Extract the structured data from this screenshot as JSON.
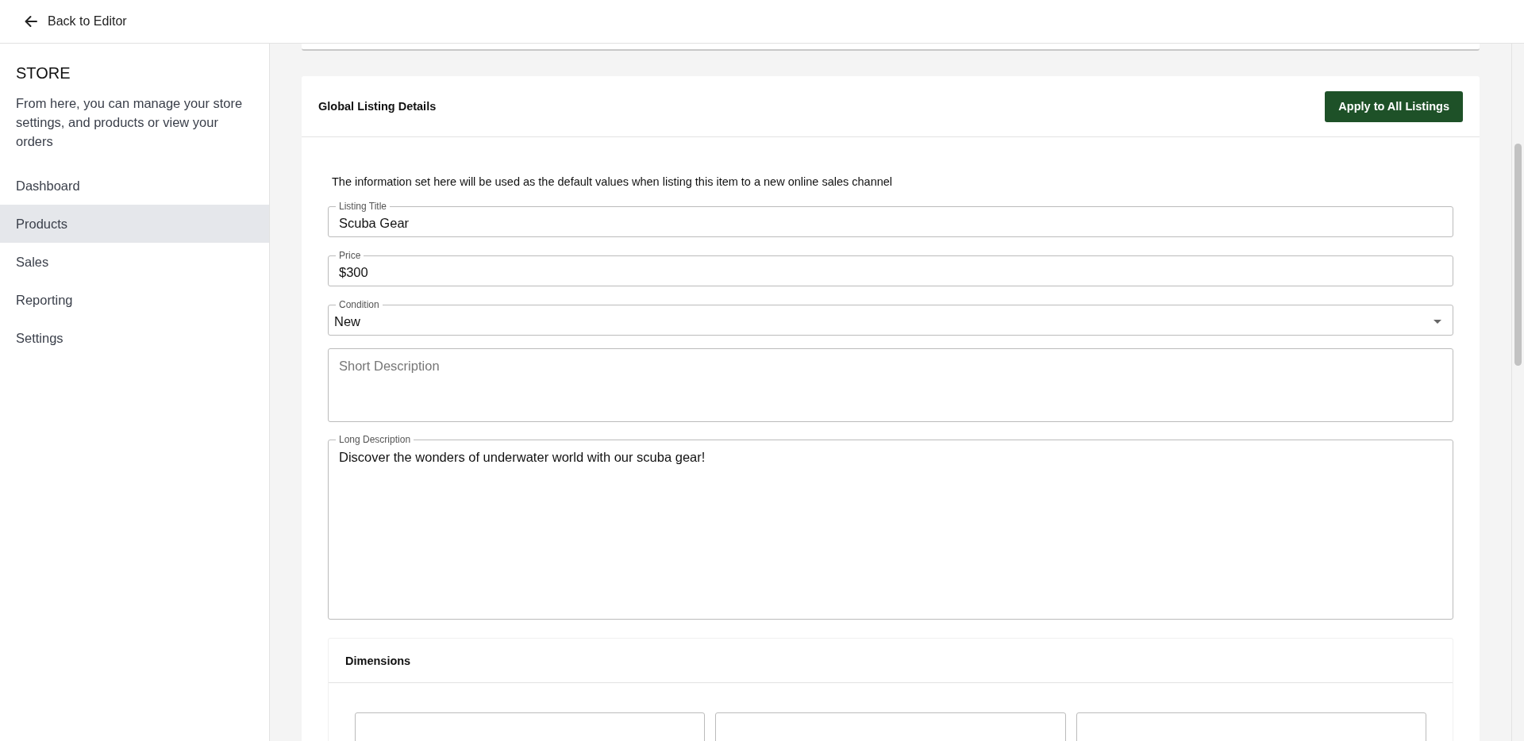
{
  "header": {
    "back_label": "Back to Editor"
  },
  "sidebar": {
    "title": "STORE",
    "description": "From here, you can manage your store settings, and products or view your orders",
    "items": [
      {
        "label": "Dashboard",
        "selected": false
      },
      {
        "label": "Products",
        "selected": true
      },
      {
        "label": "Sales",
        "selected": false
      },
      {
        "label": "Reporting",
        "selected": false
      },
      {
        "label": "Settings",
        "selected": false
      }
    ]
  },
  "listing_card": {
    "title": "Global Listing Details",
    "button": "Apply to All Listings",
    "intro": "The information set here will be used as the default values when listing this item to a new online sales channel",
    "fields": [
      {
        "kind": "text",
        "label": "Listing Title",
        "value": "Scuba Gear"
      },
      {
        "kind": "text",
        "label": "Price",
        "value": "$300"
      },
      {
        "kind": "select",
        "label": "Condition",
        "value": "New"
      },
      {
        "kind": "short_area",
        "placeholder": "Short Description"
      },
      {
        "kind": "long_area",
        "label": "Long Description",
        "value": "Discover the wonders of underwater world with our scuba gear!"
      }
    ]
  },
  "dimensions_card": {
    "title": "Dimensions",
    "fields": [
      {
        "kind": "input"
      },
      {
        "kind": "input"
      },
      {
        "kind": "input"
      }
    ]
  }
}
